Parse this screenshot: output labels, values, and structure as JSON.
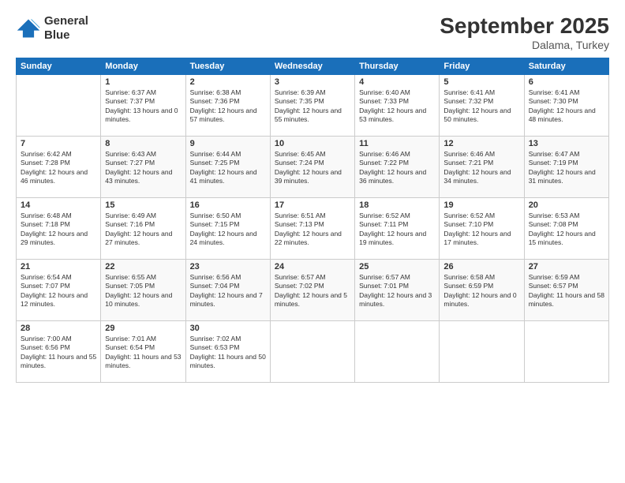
{
  "logo": {
    "line1": "General",
    "line2": "Blue"
  },
  "title": "September 2025",
  "subtitle": "Dalama, Turkey",
  "days_header": [
    "Sunday",
    "Monday",
    "Tuesday",
    "Wednesday",
    "Thursday",
    "Friday",
    "Saturday"
  ],
  "weeks": [
    [
      {
        "day": "",
        "sunrise": "",
        "sunset": "",
        "daylight": ""
      },
      {
        "day": "1",
        "sunrise": "Sunrise: 6:37 AM",
        "sunset": "Sunset: 7:37 PM",
        "daylight": "Daylight: 13 hours and 0 minutes."
      },
      {
        "day": "2",
        "sunrise": "Sunrise: 6:38 AM",
        "sunset": "Sunset: 7:36 PM",
        "daylight": "Daylight: 12 hours and 57 minutes."
      },
      {
        "day": "3",
        "sunrise": "Sunrise: 6:39 AM",
        "sunset": "Sunset: 7:35 PM",
        "daylight": "Daylight: 12 hours and 55 minutes."
      },
      {
        "day": "4",
        "sunrise": "Sunrise: 6:40 AM",
        "sunset": "Sunset: 7:33 PM",
        "daylight": "Daylight: 12 hours and 53 minutes."
      },
      {
        "day": "5",
        "sunrise": "Sunrise: 6:41 AM",
        "sunset": "Sunset: 7:32 PM",
        "daylight": "Daylight: 12 hours and 50 minutes."
      },
      {
        "day": "6",
        "sunrise": "Sunrise: 6:41 AM",
        "sunset": "Sunset: 7:30 PM",
        "daylight": "Daylight: 12 hours and 48 minutes."
      }
    ],
    [
      {
        "day": "7",
        "sunrise": "Sunrise: 6:42 AM",
        "sunset": "Sunset: 7:28 PM",
        "daylight": "Daylight: 12 hours and 46 minutes."
      },
      {
        "day": "8",
        "sunrise": "Sunrise: 6:43 AM",
        "sunset": "Sunset: 7:27 PM",
        "daylight": "Daylight: 12 hours and 43 minutes."
      },
      {
        "day": "9",
        "sunrise": "Sunrise: 6:44 AM",
        "sunset": "Sunset: 7:25 PM",
        "daylight": "Daylight: 12 hours and 41 minutes."
      },
      {
        "day": "10",
        "sunrise": "Sunrise: 6:45 AM",
        "sunset": "Sunset: 7:24 PM",
        "daylight": "Daylight: 12 hours and 39 minutes."
      },
      {
        "day": "11",
        "sunrise": "Sunrise: 6:46 AM",
        "sunset": "Sunset: 7:22 PM",
        "daylight": "Daylight: 12 hours and 36 minutes."
      },
      {
        "day": "12",
        "sunrise": "Sunrise: 6:46 AM",
        "sunset": "Sunset: 7:21 PM",
        "daylight": "Daylight: 12 hours and 34 minutes."
      },
      {
        "day": "13",
        "sunrise": "Sunrise: 6:47 AM",
        "sunset": "Sunset: 7:19 PM",
        "daylight": "Daylight: 12 hours and 31 minutes."
      }
    ],
    [
      {
        "day": "14",
        "sunrise": "Sunrise: 6:48 AM",
        "sunset": "Sunset: 7:18 PM",
        "daylight": "Daylight: 12 hours and 29 minutes."
      },
      {
        "day": "15",
        "sunrise": "Sunrise: 6:49 AM",
        "sunset": "Sunset: 7:16 PM",
        "daylight": "Daylight: 12 hours and 27 minutes."
      },
      {
        "day": "16",
        "sunrise": "Sunrise: 6:50 AM",
        "sunset": "Sunset: 7:15 PM",
        "daylight": "Daylight: 12 hours and 24 minutes."
      },
      {
        "day": "17",
        "sunrise": "Sunrise: 6:51 AM",
        "sunset": "Sunset: 7:13 PM",
        "daylight": "Daylight: 12 hours and 22 minutes."
      },
      {
        "day": "18",
        "sunrise": "Sunrise: 6:52 AM",
        "sunset": "Sunset: 7:11 PM",
        "daylight": "Daylight: 12 hours and 19 minutes."
      },
      {
        "day": "19",
        "sunrise": "Sunrise: 6:52 AM",
        "sunset": "Sunset: 7:10 PM",
        "daylight": "Daylight: 12 hours and 17 minutes."
      },
      {
        "day": "20",
        "sunrise": "Sunrise: 6:53 AM",
        "sunset": "Sunset: 7:08 PM",
        "daylight": "Daylight: 12 hours and 15 minutes."
      }
    ],
    [
      {
        "day": "21",
        "sunrise": "Sunrise: 6:54 AM",
        "sunset": "Sunset: 7:07 PM",
        "daylight": "Daylight: 12 hours and 12 minutes."
      },
      {
        "day": "22",
        "sunrise": "Sunrise: 6:55 AM",
        "sunset": "Sunset: 7:05 PM",
        "daylight": "Daylight: 12 hours and 10 minutes."
      },
      {
        "day": "23",
        "sunrise": "Sunrise: 6:56 AM",
        "sunset": "Sunset: 7:04 PM",
        "daylight": "Daylight: 12 hours and 7 minutes."
      },
      {
        "day": "24",
        "sunrise": "Sunrise: 6:57 AM",
        "sunset": "Sunset: 7:02 PM",
        "daylight": "Daylight: 12 hours and 5 minutes."
      },
      {
        "day": "25",
        "sunrise": "Sunrise: 6:57 AM",
        "sunset": "Sunset: 7:01 PM",
        "daylight": "Daylight: 12 hours and 3 minutes."
      },
      {
        "day": "26",
        "sunrise": "Sunrise: 6:58 AM",
        "sunset": "Sunset: 6:59 PM",
        "daylight": "Daylight: 12 hours and 0 minutes."
      },
      {
        "day": "27",
        "sunrise": "Sunrise: 6:59 AM",
        "sunset": "Sunset: 6:57 PM",
        "daylight": "Daylight: 11 hours and 58 minutes."
      }
    ],
    [
      {
        "day": "28",
        "sunrise": "Sunrise: 7:00 AM",
        "sunset": "Sunset: 6:56 PM",
        "daylight": "Daylight: 11 hours and 55 minutes."
      },
      {
        "day": "29",
        "sunrise": "Sunrise: 7:01 AM",
        "sunset": "Sunset: 6:54 PM",
        "daylight": "Daylight: 11 hours and 53 minutes."
      },
      {
        "day": "30",
        "sunrise": "Sunrise: 7:02 AM",
        "sunset": "Sunset: 6:53 PM",
        "daylight": "Daylight: 11 hours and 50 minutes."
      },
      {
        "day": "",
        "sunrise": "",
        "sunset": "",
        "daylight": ""
      },
      {
        "day": "",
        "sunrise": "",
        "sunset": "",
        "daylight": ""
      },
      {
        "day": "",
        "sunrise": "",
        "sunset": "",
        "daylight": ""
      },
      {
        "day": "",
        "sunrise": "",
        "sunset": "",
        "daylight": ""
      }
    ]
  ]
}
